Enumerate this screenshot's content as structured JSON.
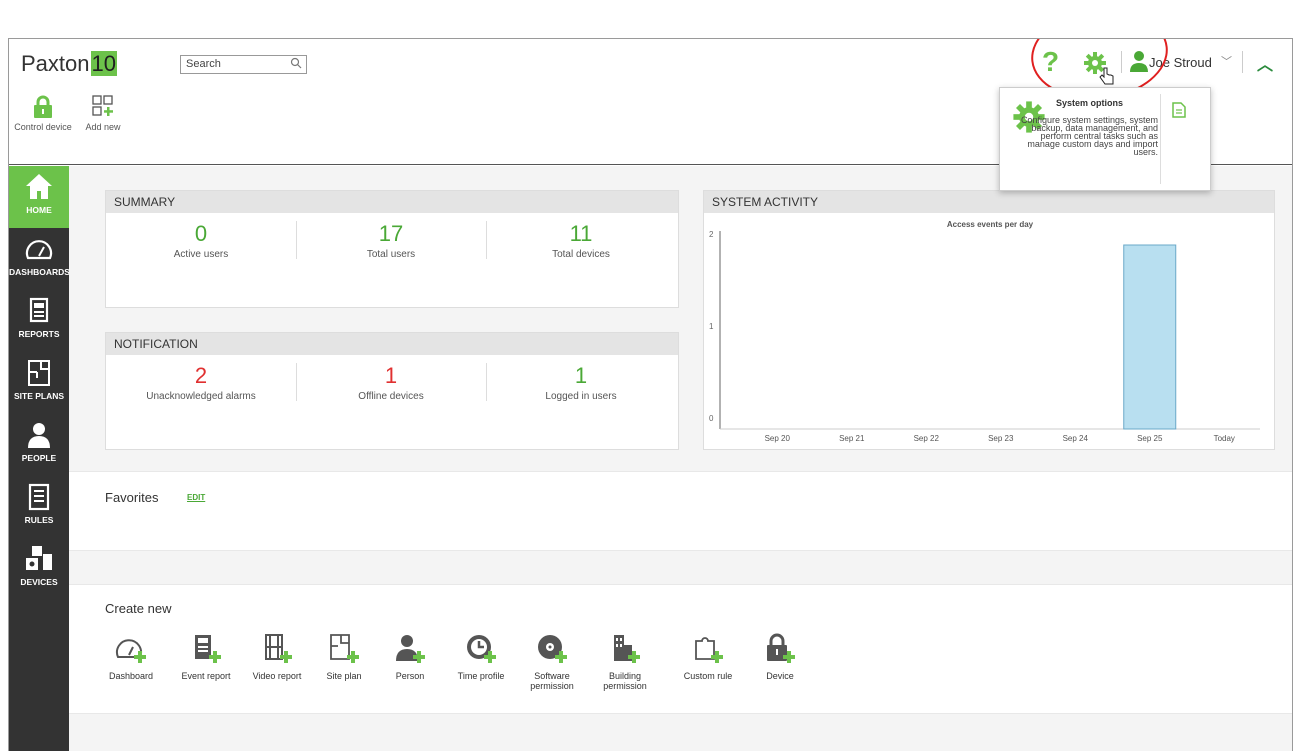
{
  "app": {
    "logo_text": "Paxton",
    "logo_number": "10"
  },
  "search": {
    "placeholder": "Search"
  },
  "toolbar": {
    "control_device": "Control device",
    "add_new": "Add new"
  },
  "user": {
    "name": "Joe Stroud"
  },
  "popup": {
    "title": "System options",
    "description": "Configure system settings, system backup, data management, and perform central tasks such as manage custom days and import users."
  },
  "nav": [
    {
      "label": "HOME",
      "icon": "home-icon",
      "active": true
    },
    {
      "label": "DASHBOARDS",
      "icon": "dashboard-icon"
    },
    {
      "label": "REPORTS",
      "icon": "reports-icon"
    },
    {
      "label": "SITE PLANS",
      "icon": "site-plan-icon"
    },
    {
      "label": "PEOPLE",
      "icon": "person-icon"
    },
    {
      "label": "RULES",
      "icon": "rules-icon"
    },
    {
      "label": "DEVICES",
      "icon": "devices-icon"
    }
  ],
  "summary": {
    "title": "SUMMARY",
    "stats": [
      {
        "value": "0",
        "label": "Active users"
      },
      {
        "value": "17",
        "label": "Total users"
      },
      {
        "value": "11",
        "label": "Total devices"
      }
    ]
  },
  "notification": {
    "title": "NOTIFICATION",
    "stats": [
      {
        "value": "2",
        "label": "Unacknowledged alarms"
      },
      {
        "value": "1",
        "label": "Offline devices"
      },
      {
        "value": "1",
        "label": "Logged in users"
      }
    ]
  },
  "activity": {
    "title": "SYSTEM ACTIVITY"
  },
  "chart_data": {
    "type": "bar",
    "title": "Access events per day",
    "categories": [
      "Sep 20",
      "Sep 21",
      "Sep 22",
      "Sep 23",
      "Sep 24",
      "Sep 25",
      "Today"
    ],
    "values": [
      0,
      0,
      0,
      0,
      0,
      2,
      0
    ],
    "yticks": [
      "0",
      "1",
      "2"
    ],
    "ylim": [
      0,
      2
    ],
    "bar_color": "#b8dff0"
  },
  "favorites": {
    "title": "Favorites",
    "edit": "EDIT"
  },
  "create_new": {
    "title": "Create new",
    "items": [
      {
        "label": "Dashboard"
      },
      {
        "label": "Event report"
      },
      {
        "label": "Video report"
      },
      {
        "label": "Site plan"
      },
      {
        "label": "Person"
      },
      {
        "label": "Time profile"
      },
      {
        "label": "Software",
        "label2": "permission"
      },
      {
        "label": "Building",
        "label2": "permission"
      },
      {
        "label": "Custom rule"
      },
      {
        "label": "Device"
      }
    ]
  },
  "colors": {
    "accent": "#6cc24a",
    "alert": "#e03030",
    "sidebar": "#333333"
  }
}
